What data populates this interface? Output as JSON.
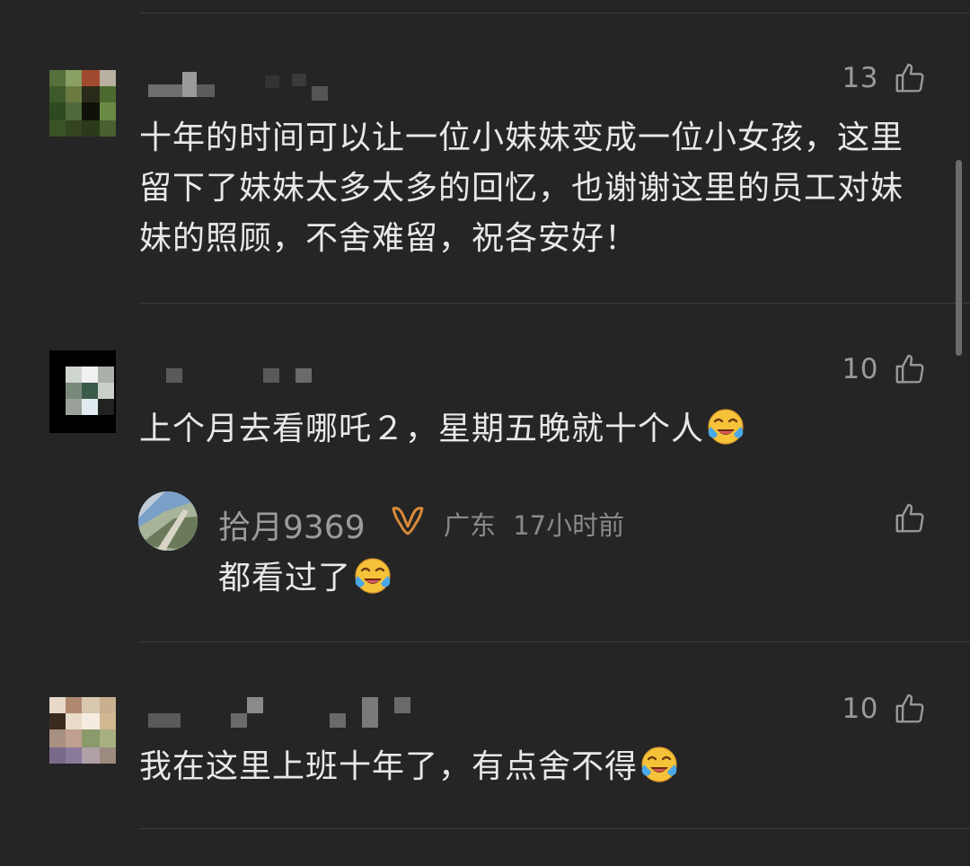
{
  "comments": [
    {
      "likes": "13",
      "text": "十年的时间可以让一位小妹妹变成一位小女孩，这里留下了妹妹太多太多的回忆，也谢谢这里的员工对妹妹的照顾，不舍难留，祝各安好！"
    },
    {
      "likes": "10",
      "text": "上个月去看哪吒２，星期五晚就十个人",
      "emoji": "crying-laughing-emoji",
      "reply": {
        "username": "拾月9369",
        "location": "广东",
        "time": "17小时前",
        "text": "都看过了",
        "emoji": "crying-laughing-emoji"
      }
    },
    {
      "likes": "10",
      "text": "我在这里上班十年了，有点舍不得",
      "emoji": "crying-laughing-emoji"
    }
  ],
  "colors": {
    "background": "#252525",
    "text": "#e8e8e8",
    "muted": "#9a9a9a",
    "badge": "#d98a3a"
  },
  "icons": [
    "thumbs-up-icon",
    "crying-laughing-emoji",
    "vip-badge-icon"
  ]
}
